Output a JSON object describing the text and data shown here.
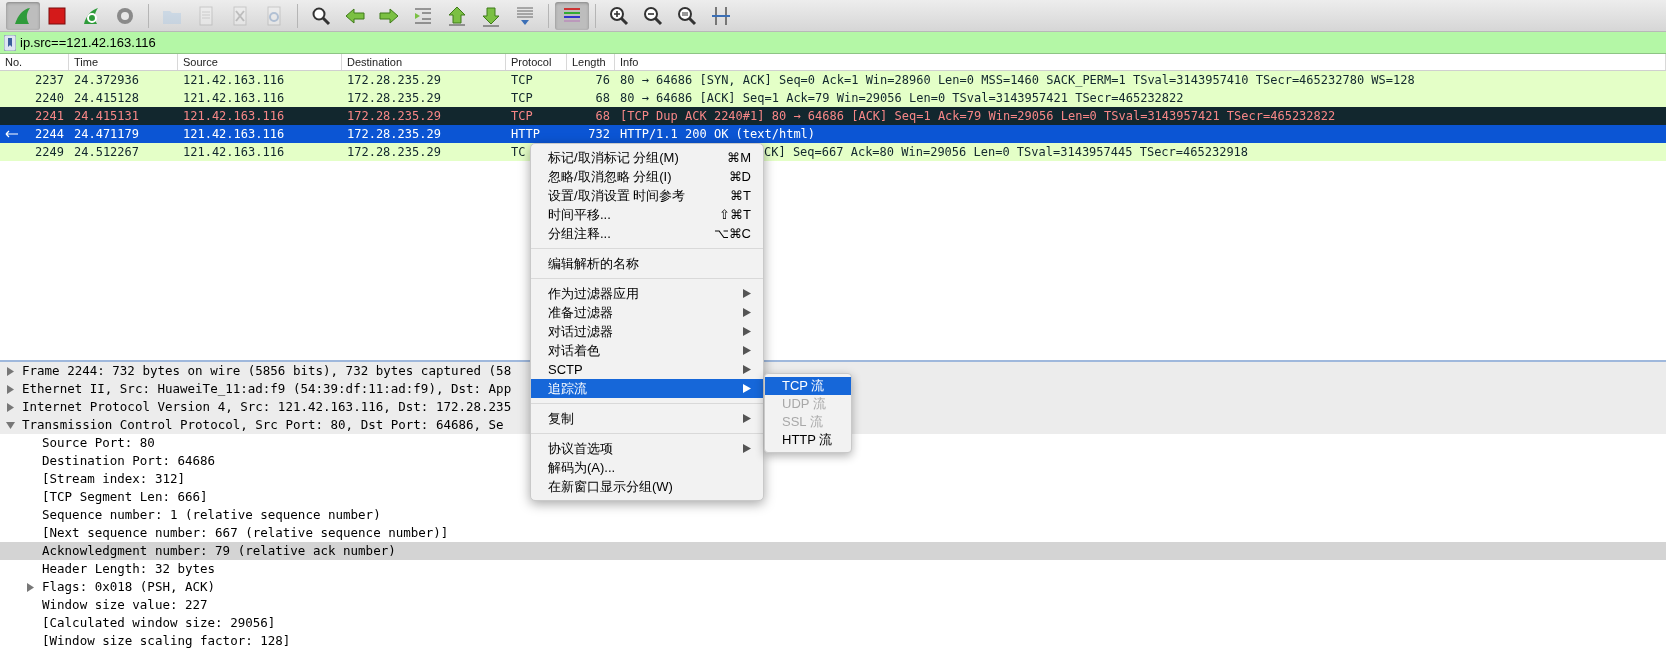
{
  "toolbar": {
    "groups": [
      {
        "buttons": [
          {
            "pressed": true,
            "disabled": false
          },
          {
            "pressed": false,
            "disabled": false
          },
          {
            "pressed": false,
            "disabled": false
          },
          {
            "pressed": false,
            "disabled": false
          }
        ]
      },
      {
        "buttons": [
          {
            "pressed": false,
            "disabled": true
          },
          {
            "pressed": false,
            "disabled": true
          },
          {
            "pressed": false,
            "disabled": true
          },
          {
            "pressed": false,
            "disabled": true
          }
        ]
      },
      {
        "buttons": [
          {
            "pressed": false,
            "disabled": false
          },
          {
            "pressed": false,
            "disabled": false
          },
          {
            "pressed": false,
            "disabled": false
          },
          {
            "pressed": false,
            "disabled": false
          },
          {
            "pressed": false,
            "disabled": false
          },
          {
            "pressed": false,
            "disabled": false
          },
          {
            "pressed": false,
            "disabled": false
          }
        ]
      },
      {
        "buttons": [
          {
            "pressed": true,
            "disabled": false
          }
        ]
      },
      {
        "buttons": [
          {
            "pressed": false,
            "disabled": false
          },
          {
            "pressed": false,
            "disabled": false
          },
          {
            "pressed": false,
            "disabled": false
          },
          {
            "pressed": false,
            "disabled": false
          }
        ]
      }
    ]
  },
  "filter": {
    "value": "ip.src==121.42.163.116"
  },
  "packet_list": {
    "columns": [
      "No.",
      "Time",
      "Source",
      "Destination",
      "Protocol",
      "Length",
      "Info"
    ],
    "rows": [
      {
        "no": "2237",
        "time": "24.372936",
        "source": "121.42.163.116",
        "destination": "172.28.235.29",
        "protocol": "TCP",
        "length": "76",
        "info": "80 → 64686 [SYN, ACK] Seq=0 Ack=1 Win=28960 Len=0 MSS=1460 SACK_PERM=1 TSval=3143957410 TSecr=465232780 WS=128",
        "color": "#e4ffc7",
        "selected": false
      },
      {
        "no": "2240",
        "time": "24.415128",
        "source": "121.42.163.116",
        "destination": "172.28.235.29",
        "protocol": "TCP",
        "length": "68",
        "info": "80 → 64686 [ACK] Seq=1 Ack=79 Win=29056 Len=0 TSval=3143957421 TSecr=465232822",
        "color": "#e4ffc7",
        "selected": false
      },
      {
        "no": "2241",
        "time": "24.415131",
        "source": "121.42.163.116",
        "destination": "172.28.235.29",
        "protocol": "TCP",
        "length": "68",
        "info": "[TCP Dup ACK 2240#1] 80 → 64686 [ACK] Seq=1 Ack=79 Win=29056 Len=0 TSval=3143957421 TSecr=465232822",
        "color": "#12272e",
        "selected": false
      },
      {
        "no": "2244",
        "time": "24.471179",
        "source": "121.42.163.116",
        "destination": "172.28.235.29",
        "protocol": "HTTP",
        "length": "732",
        "info": "HTTP/1.1 200 OK  (text/html)",
        "selected": true,
        "related": true
      },
      {
        "no": "2249",
        "time": "24.512267",
        "source": "121.42.163.116",
        "destination": "172.28.235.29",
        "protocol": "TC",
        "info": "CK] Seq=667 Ack=80 Win=29056 Len=0 TSval=3143957445 TSecr=465232918",
        "color": "#e4ffc7",
        "selected": false,
        "covered": true
      }
    ]
  },
  "details": [
    {
      "text": "Frame 2244: 732 bytes on wire (5856 bits), 732 bytes captured (58",
      "expanded": false,
      "selected": false
    },
    {
      "text": "Ethernet II, Src: HuaweiTe_11:ad:f9 (54:39:df:11:ad:f9), Dst: App",
      "expanded": false,
      "selected": false
    },
    {
      "text": "Internet Protocol Version 4, Src: 121.42.163.116, Dst: 172.28.235",
      "expanded": false,
      "selected": false
    },
    {
      "text": "Transmission Control Protocol, Src Port: 80, Dst Port: 64686, Se",
      "expanded": true,
      "selected": false,
      "children": [
        {
          "text": "Source Port: 80",
          "selected": false
        },
        {
          "text": "Destination Port: 64686",
          "selected": false
        },
        {
          "text": "[Stream index: 312]",
          "selected": false
        },
        {
          "text": "[TCP Segment Len: 666]",
          "selected": false
        },
        {
          "text": "Sequence number: 1    (relative sequence number)",
          "selected": false
        },
        {
          "text": "[Next sequence number: 667    (relative sequence number)]",
          "selected": false
        },
        {
          "text": "Acknowledgment number: 79    (relative ack number)",
          "selected": true
        },
        {
          "text": "Header Length: 32 bytes",
          "selected": false
        },
        {
          "text": "Flags: 0x018 (PSH, ACK)",
          "expanded": false,
          "selected": false
        },
        {
          "text": "Window size value: 227",
          "selected": false
        },
        {
          "text": "[Calculated window size: 29056]",
          "selected": false
        },
        {
          "text": "[Window size scaling factor: 128]",
          "selected": false
        }
      ]
    }
  ],
  "context_menu": {
    "items": [
      {
        "kind": "item",
        "label": "标记/取消标记 分组(M)",
        "shortcut": "⌘M",
        "submenu": false,
        "selected": false
      },
      {
        "kind": "item",
        "label": "忽略/取消忽略 分组(I)",
        "shortcut": "⌘D",
        "submenu": false,
        "selected": false
      },
      {
        "kind": "item",
        "label": "设置/取消设置 时间参考",
        "shortcut": "⌘T",
        "submenu": false,
        "selected": false
      },
      {
        "kind": "item",
        "label": "时间平移...",
        "shortcut": "⇧⌘T",
        "submenu": false,
        "selected": false
      },
      {
        "kind": "item",
        "label": "分组注释...",
        "shortcut": "⌥⌘C",
        "submenu": false,
        "selected": false
      },
      {
        "kind": "separator"
      },
      {
        "kind": "item",
        "label": "编辑解析的名称",
        "submenu": false,
        "selected": false
      },
      {
        "kind": "separator"
      },
      {
        "kind": "item",
        "label": "作为过滤器应用",
        "submenu": true,
        "selected": false
      },
      {
        "kind": "item",
        "label": "准备过滤器",
        "submenu": true,
        "selected": false
      },
      {
        "kind": "item",
        "label": "对话过滤器",
        "submenu": true,
        "selected": false
      },
      {
        "kind": "item",
        "label": "对话着色",
        "submenu": true,
        "selected": false
      },
      {
        "kind": "item",
        "label": "SCTP",
        "submenu": true,
        "selected": false
      },
      {
        "kind": "item",
        "label": "追踪流",
        "submenu": true,
        "selected": true
      },
      {
        "kind": "separator"
      },
      {
        "kind": "item",
        "label": "复制",
        "submenu": true,
        "selected": false
      },
      {
        "kind": "separator"
      },
      {
        "kind": "item",
        "label": "协议首选项",
        "submenu": true,
        "selected": false
      },
      {
        "kind": "item",
        "label": "解码为(A)...",
        "submenu": false,
        "selected": false
      },
      {
        "kind": "item",
        "label": "在新窗口显示分组(W)",
        "submenu": false,
        "selected": false
      }
    ]
  },
  "submenu": {
    "items": [
      {
        "label": "TCP 流",
        "selected": true,
        "disabled": false
      },
      {
        "label": "UDP 流",
        "selected": false,
        "disabled": true
      },
      {
        "label": "SSL 流",
        "selected": false,
        "disabled": true
      },
      {
        "label": "HTTP 流",
        "selected": false,
        "disabled": false
      }
    ]
  }
}
